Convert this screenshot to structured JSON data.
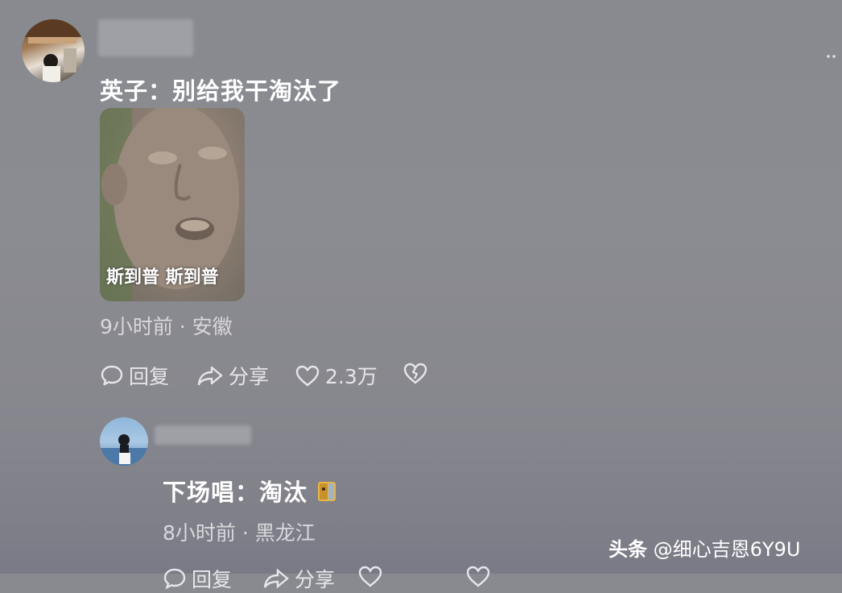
{
  "comment1": {
    "avatar_icon": "user-avatar-photo",
    "text": "英子：别给我干淘汰了",
    "sticker": {
      "caption": "斯到普 斯到普"
    },
    "meta": "9小时前 · 安徽",
    "actions": {
      "reply_label": "回复",
      "share_label": "分享",
      "like_count": "2.3万"
    }
  },
  "reply1": {
    "avatar_icon": "user-avatar-photo",
    "text": "下场唱：淘汰",
    "emoji_icon": "hamster-emoji",
    "meta": "8小时前 · 黑龙江",
    "actions": {
      "reply_label": "回复",
      "share_label": "分享"
    }
  },
  "watermark": {
    "brand": "头条",
    "handle": "@细心吉恩6Y9U"
  }
}
